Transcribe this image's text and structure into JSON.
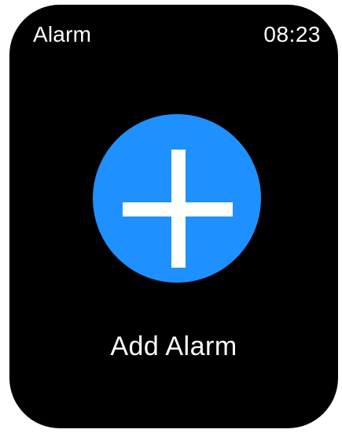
{
  "status_bar": {
    "title": "Alarm",
    "time": "08:23"
  },
  "main": {
    "add_button_icon": "plus-icon",
    "add_label": "Add Alarm"
  },
  "colors": {
    "background": "#000000",
    "accent": "#1e90ff",
    "text": "#ffffff"
  }
}
